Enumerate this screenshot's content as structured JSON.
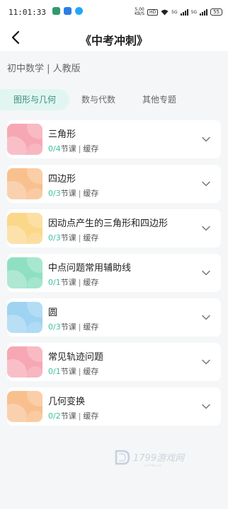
{
  "status_bar": {
    "time": "11:01:33",
    "speed_top": "5.00",
    "speed_unit": "KB/S",
    "hd": "HD",
    "net1": "5G",
    "net2": "5G",
    "battery": "55"
  },
  "header": {
    "back_icon": "chevron-left-icon",
    "title": "《中考冲刺》"
  },
  "subtitle": "初中数学 | 人教版",
  "tabs": [
    {
      "label": "图形与几何",
      "active": true
    },
    {
      "label": "数与代数",
      "active": false
    },
    {
      "label": "其他专题",
      "active": false
    }
  ],
  "courses": [
    {
      "title": "三角形",
      "progress": "0/4",
      "unit": "节课",
      "cache": "缓存",
      "color": "#f7a7b3"
    },
    {
      "title": "四边形",
      "progress": "0/3",
      "unit": "节课",
      "cache": "缓存",
      "color": "#f9c08f"
    },
    {
      "title": "因动点产生的三角形和四边形",
      "progress": "0/3",
      "unit": "节课",
      "cache": "缓存",
      "color": "#fbd78a"
    },
    {
      "title": "中点问题常用辅助线",
      "progress": "0/1",
      "unit": "节课",
      "cache": "缓存",
      "color": "#8fe0c3"
    },
    {
      "title": "圆",
      "progress": "0/3",
      "unit": "节课",
      "cache": "缓存",
      "color": "#9ed3f2"
    },
    {
      "title": "常见轨迹问题",
      "progress": "0/1",
      "unit": "节课",
      "cache": "缓存",
      "color": "#f7a7b3"
    },
    {
      "title": "几何变换",
      "progress": "0/2",
      "unit": "节课",
      "cache": "缓存",
      "color": "#f9c08f"
    }
  ],
  "watermark": {
    "text": "1799游戏网"
  }
}
